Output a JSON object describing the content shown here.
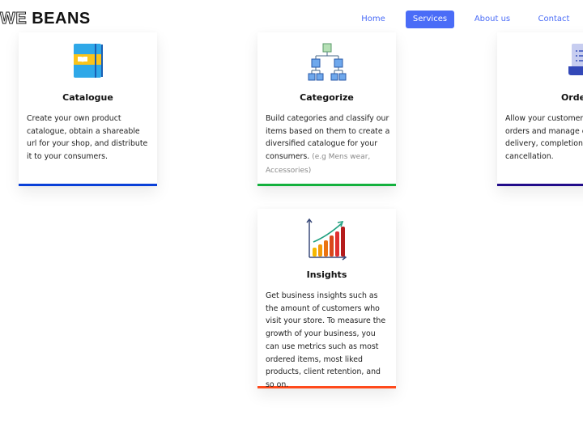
{
  "brand": {
    "outline_text": "WE",
    "solid_text": "BEANS"
  },
  "nav": {
    "items": [
      {
        "label": "Home",
        "active": false
      },
      {
        "label": "Services",
        "active": true
      },
      {
        "label": "About us",
        "active": false
      },
      {
        "label": "Contact",
        "active": false
      }
    ]
  },
  "colors": {
    "accent": "#4a6cf7",
    "catalogue_border": "#0a40d8",
    "categorize_border": "#14b13e",
    "orders_border": "#220c8a",
    "insights_border": "#ff4a1c"
  },
  "services": {
    "catalogue": {
      "icon": "notebook-icon",
      "title": "Catalogue",
      "description": "Create your own product catalogue, obtain a shareable url for your shop, and distribute it to your consumers."
    },
    "categorize": {
      "icon": "hierarchy-icon",
      "title": "Categorize",
      "description": "Build categories and classify our items based on them to create a diversified catalogue for your consumers.",
      "example": "(e.g Mens wear, Accessories)"
    },
    "orders": {
      "icon": "document-list-icon",
      "title": "Orders",
      "description": "Allow your customers to place orders and manage order delivery, completion, and cancellation."
    },
    "insights": {
      "icon": "growth-chart-icon",
      "title": "Insights",
      "description": "Get business insights such as the amount of customers who visit your store. To measure the growth of your business, you can use metrics such as most ordered items, most liked products, client retention, and so on."
    }
  }
}
